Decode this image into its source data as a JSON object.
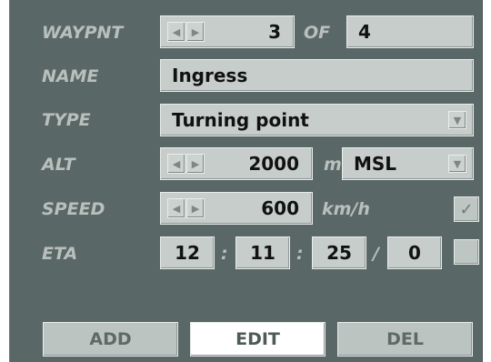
{
  "waypoint": {
    "label": "WAYPNT",
    "value": "3",
    "of_label": "OF",
    "total": "4"
  },
  "name": {
    "label": "NAME",
    "value": "Ingress"
  },
  "type": {
    "label": "TYPE",
    "value": "Turning point"
  },
  "alt": {
    "label": "ALT",
    "value": "2000",
    "unit": "m",
    "reference": "MSL"
  },
  "speed": {
    "label": "SPEED",
    "value": "600",
    "unit": "km/h",
    "checked": true
  },
  "eta": {
    "label": "ETA",
    "hours": "12",
    "minutes": "11",
    "seconds": "25",
    "sep_colon": ":",
    "sep_slash": "/",
    "day": "0",
    "checked": false
  },
  "icons": {
    "left": "◀",
    "right": "▶",
    "down": "▼",
    "check": "✓"
  },
  "buttons": {
    "add": "ADD",
    "edit": "EDIT",
    "delete": "DEL"
  },
  "colors": {
    "panel": "#5a6767",
    "label": "#b9c0bc",
    "field": "#c6cdca",
    "active_button": "#ffffff"
  }
}
